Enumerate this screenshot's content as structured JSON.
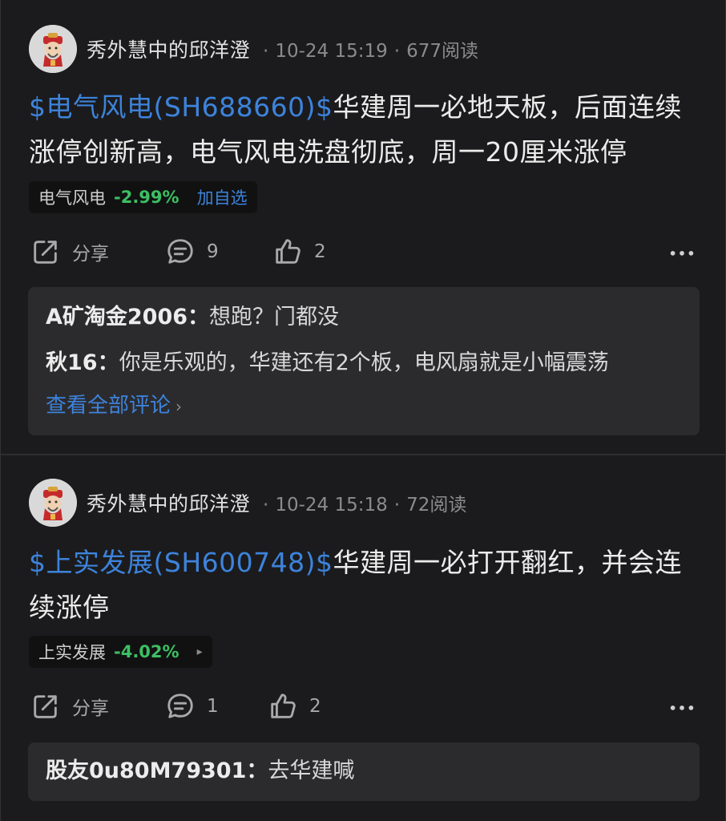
{
  "posts": [
    {
      "author": "秀外慧中的邱洋澄",
      "time": "10-24 15:19",
      "views": "677阅读",
      "stock_tag": "$电气风电(SH688660)$",
      "text": "华建周一必地天板，后面连续涨停创新高，电气风电洗盘彻底，周一20厘米涨停",
      "chip": {
        "name": "电气风电",
        "change": "-2.99%",
        "action": "加自选"
      },
      "share_label": "分享",
      "comment_count": "9",
      "like_count": "2",
      "comments": [
        {
          "user": "A矿淘金2006：",
          "text": "想跑？门都没"
        },
        {
          "user": "秋16：",
          "text": "你是乐观的，华建还有2个板，电风扇就是小幅震荡"
        }
      ],
      "view_all": "查看全部评论"
    },
    {
      "author": "秀外慧中的邱洋澄",
      "time": "10-24 15:18",
      "views": "72阅读",
      "stock_tag": "$上实发展(SH600748)$",
      "text": "华建周一必打开翻红，并会连续涨停",
      "chip": {
        "name": "上实发展",
        "change": "-4.02%",
        "arrow": "▸"
      },
      "share_label": "分享",
      "comment_count": "1",
      "like_count": "2",
      "comments": [
        {
          "user": "股友0u80M79301：",
          "text": "去华建喊"
        }
      ]
    }
  ],
  "colors": {
    "background": "#1b1b1d",
    "link": "#3d83db",
    "rise_fall_green": "#3dbf63",
    "comment_box": "#2b2b2e"
  },
  "icons": [
    "share-icon",
    "comment-icon",
    "like-icon",
    "more-icon",
    "avatar-icon",
    "chevron-right-icon"
  ]
}
